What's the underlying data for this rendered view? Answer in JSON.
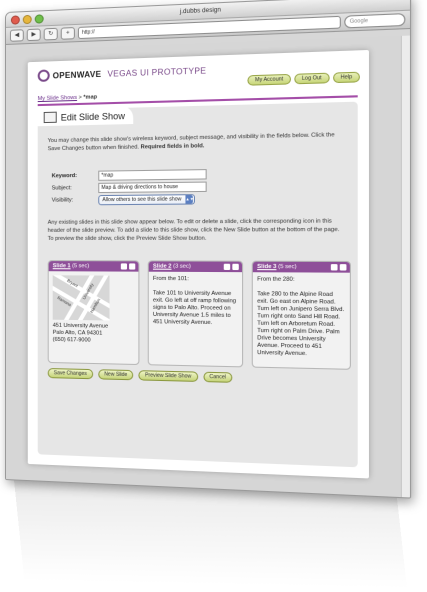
{
  "browser": {
    "window_title": "j.dubbs design",
    "address": "http://",
    "search_placeholder": "Google"
  },
  "header": {
    "brand": "OPENWAVE",
    "product": "VEGAS UI PROTOTYPE",
    "links": [
      "My Account",
      "Log Out",
      "Help"
    ]
  },
  "breadcrumb": {
    "parent": "My Slide Shows",
    "separator": " > ",
    "current": "*map"
  },
  "panel": {
    "title": "Edit Slide Show",
    "intro": "You may change this slide show's wireless keyword, subject message, and visibility in the fields below. Click the Save Changes button when finished.",
    "intro_bold": "Required fields in bold."
  },
  "form": {
    "keyword_label": "Keyword:",
    "keyword_value": "*map",
    "subject_label": "Subject:",
    "subject_value": "Map & driving directions to house",
    "visibility_label": "Visibility:",
    "visibility_value": "Allow others to see this slide show"
  },
  "slides_intro": "Any existing slides in this slide show appear below. To edit or delete a slide, click the corresponding icon in this header of the slide preview. To add a slide to this slide show, click the New Slide button at the bottom of the page. To preview the slide show, click the Preview Slide Show button.",
  "slides": [
    {
      "title": "Slide 1",
      "duration": "(5 sec)",
      "text": "451 University Avenue\nPalo Alto, CA 94301\n(650) 617-9000",
      "map_labels": [
        "Bryant",
        "University",
        "Ramona",
        "Hamilton"
      ]
    },
    {
      "title": "Slide 2",
      "duration": "(3 sec)",
      "text": "From the 101:\n\nTake 101 to University Avenue exit. Go left at off ramp following signs to Palo Alto. Proceed on University Avenue 1.5 miles to 451 University Avenue."
    },
    {
      "title": "Slide 3",
      "duration": "(5 sec)",
      "text": "From the 280:\n\nTake 280 to the Alpine Road exit. Go east on Alpine Road. Turn left on Junipero Serra Blvd. Turn right onto Sand Hill Road. Turn left on Arboretum Road. Turn right on Palm Drive. Palm Drive becomes University Avenue. Proceed to 451 University Avenue."
    }
  ],
  "buttons": [
    "Save Changes",
    "New Slide",
    "Preview Slide Show",
    "Cancel"
  ],
  "colors": {
    "accent": "#8e4f99",
    "button": "#c8d67a"
  }
}
